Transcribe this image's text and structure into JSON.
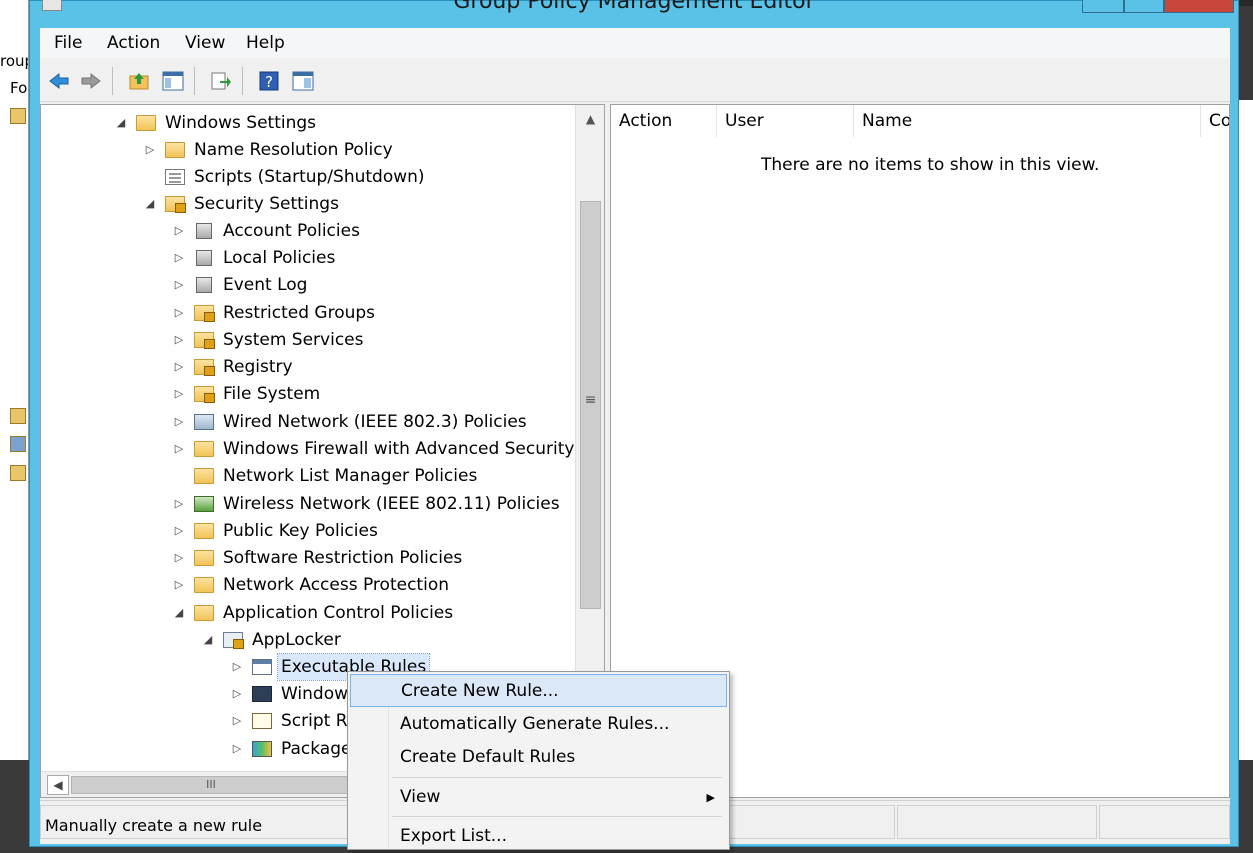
{
  "window": {
    "title": "Group Policy Management Editor",
    "title_shown": "Group Policy Management Editor"
  },
  "background_window": {
    "items": [
      "roup",
      "Fo"
    ]
  },
  "menubar": {
    "items": [
      "File",
      "Action",
      "View",
      "Help"
    ]
  },
  "toolbar": {
    "buttons": [
      "back-arrow-icon",
      "forward-arrow-icon",
      "up-folder-icon",
      "show-hide-tree-icon",
      "export-list-icon",
      "help-icon",
      "action-pane-icon"
    ]
  },
  "tree": {
    "items": [
      {
        "label": "Windows Settings",
        "icon": "folder",
        "expanded": true
      },
      {
        "label": "Name Resolution Policy",
        "icon": "folder",
        "expanded": false
      },
      {
        "label": "Scripts (Startup/Shutdown)",
        "icon": "doc"
      },
      {
        "label": "Security Settings",
        "icon": "lockfolder",
        "expanded": true
      },
      {
        "label": "Account Policies",
        "icon": "server",
        "expanded": false
      },
      {
        "label": "Local Policies",
        "icon": "server",
        "expanded": false
      },
      {
        "label": "Event Log",
        "icon": "server",
        "expanded": false
      },
      {
        "label": "Restricted Groups",
        "icon": "lockfolder",
        "expanded": false
      },
      {
        "label": "System Services",
        "icon": "lockfolder",
        "expanded": false
      },
      {
        "label": "Registry",
        "icon": "lockfolder",
        "expanded": false
      },
      {
        "label": "File System",
        "icon": "lockfolder",
        "expanded": false
      },
      {
        "label": "Wired Network (IEEE 802.3) Policies",
        "icon": "network",
        "expanded": false
      },
      {
        "label": "Windows Firewall with Advanced Security",
        "icon": "folder",
        "expanded": false
      },
      {
        "label": "Network List Manager Policies",
        "icon": "folder"
      },
      {
        "label": "Wireless Network (IEEE 802.11) Policies",
        "icon": "wireless",
        "expanded": false
      },
      {
        "label": "Public Key Policies",
        "icon": "folder",
        "expanded": false
      },
      {
        "label": "Software Restriction Policies",
        "icon": "folder",
        "expanded": false
      },
      {
        "label": "Network Access Protection",
        "icon": "folder",
        "expanded": false
      },
      {
        "label": "Application Control Policies",
        "icon": "folder",
        "expanded": true
      },
      {
        "label": "AppLocker",
        "icon": "applocker",
        "expanded": true
      },
      {
        "label": "Executable Rules",
        "icon": "exec",
        "expanded": false,
        "selected": true
      },
      {
        "label": "Window",
        "icon": "winapp",
        "expanded": false
      },
      {
        "label": "Script Ru",
        "icon": "script",
        "expanded": false
      },
      {
        "label": "Package",
        "icon": "package",
        "expanded": false
      }
    ]
  },
  "list": {
    "columns": [
      "Action",
      "User",
      "Name",
      "Co"
    ],
    "empty_message": "There are no items to show in this view."
  },
  "status": {
    "text": "Manually create a new rule"
  },
  "context_menu": {
    "items": [
      "Create New Rule...",
      "Automatically Generate Rules...",
      "Create Default Rules",
      "View",
      "Export List..."
    ],
    "highlighted": "Create New Rule..."
  },
  "scrollbar": {
    "grip": "≡",
    "hgrip": "III"
  }
}
